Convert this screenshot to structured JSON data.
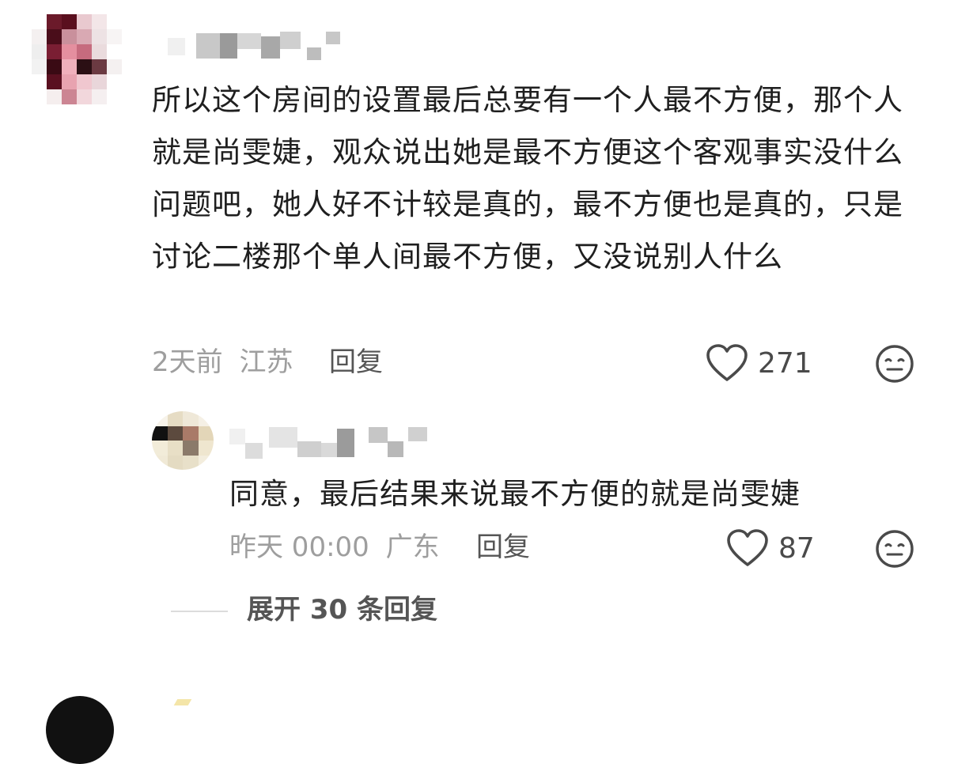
{
  "comment": {
    "text": "所以这个房间的设置最后总要有一个人最不方便，那个人就是尚雯婕，观众说出她是最不方便这个客观事实没什么问题吧，她人好不计较是真的，最不方便也是真的，只是讨论二楼那个单人间最不方便，又没说别人什么",
    "time": "2天前",
    "location": "江苏",
    "reply_label": "回复",
    "likes": "271",
    "like_icon": "heart-outline-icon",
    "dislike_icon": "meh-face-icon"
  },
  "reply": {
    "text": "同意，最后结果来说最不方便的就是尚雯婕",
    "time": "昨天 00:00",
    "location": "广东",
    "reply_label": "回复",
    "likes": "87",
    "like_icon": "heart-outline-icon",
    "dislike_icon": "meh-face-icon"
  },
  "expand": {
    "label": "展开 30 条回复"
  },
  "colors": {
    "text": "#1f1f1f",
    "meta": "#9e9e9e",
    "action": "#555555",
    "divider": "#dcdcdc"
  }
}
